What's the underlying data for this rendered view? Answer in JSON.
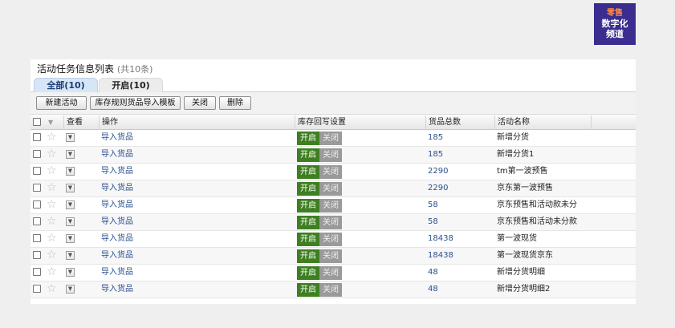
{
  "logo": {
    "line1": "零售",
    "line2": "数字化",
    "line3": "频道"
  },
  "page": {
    "title": "活动任务信息列表",
    "count": "(共10条)"
  },
  "tabs": [
    {
      "label": "全部(10)"
    },
    {
      "label": "开启(10)"
    }
  ],
  "toolbar": {
    "new_label": "新建活动",
    "import_label": "库存规则货品导入模板",
    "close_label": "关闭",
    "delete_label": "删除"
  },
  "headers": {
    "view": "查看",
    "action": "操作",
    "stock": "库存回写设置",
    "total": "货品总数",
    "name": "活动名称"
  },
  "toggle": {
    "on": "开启",
    "off": "关闭"
  },
  "rows": [
    {
      "action": "导入货品",
      "total": "185",
      "name": "新增分货"
    },
    {
      "action": "导入货品",
      "total": "185",
      "name": "新增分货1"
    },
    {
      "action": "导入货品",
      "total": "2290",
      "name": "tm第一波预售"
    },
    {
      "action": "导入货品",
      "total": "2290",
      "name": "京东第一波预售"
    },
    {
      "action": "导入货品",
      "total": "58",
      "name": "京东预售和活动款未分"
    },
    {
      "action": "导入货品",
      "total": "58",
      "name": "京东预售和活动未分款"
    },
    {
      "action": "导入货品",
      "total": "18438",
      "name": "第一波现货"
    },
    {
      "action": "导入货品",
      "total": "18438",
      "name": "第一波现货京东"
    },
    {
      "action": "导入货品",
      "total": "48",
      "name": "新增分货明细"
    },
    {
      "action": "导入货品",
      "total": "48",
      "name": "新增分货明细2"
    }
  ],
  "colors": {
    "on_green": "#3e7f21",
    "off_gray": "#9a9a9a",
    "link_blue": "#2a4f8f",
    "logo_bg": "#3b2d8f"
  }
}
